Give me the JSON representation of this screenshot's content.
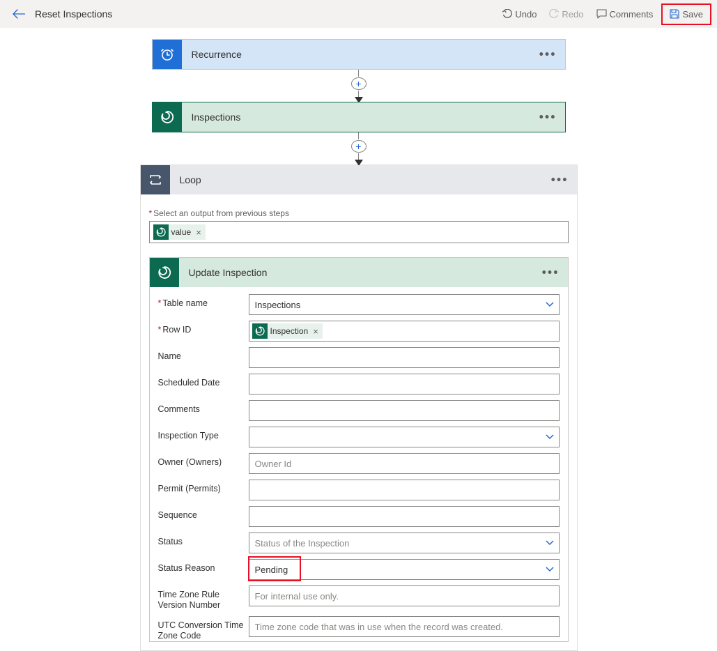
{
  "header": {
    "title": "Reset Inspections",
    "undo": "Undo",
    "redo": "Redo",
    "comments": "Comments",
    "save": "Save"
  },
  "steps": {
    "recurrence": {
      "title": "Recurrence"
    },
    "inspections": {
      "title": "Inspections"
    },
    "loop": {
      "title": "Loop",
      "selectLabel": "Select an output from previous steps",
      "valueToken": "value"
    },
    "update": {
      "title": "Update Inspection",
      "fields": {
        "tableName": {
          "label": "Table name",
          "value": "Inspections",
          "required": true
        },
        "rowId": {
          "label": "Row ID",
          "token": "Inspection",
          "required": true
        },
        "name": {
          "label": "Name"
        },
        "scheduledDate": {
          "label": "Scheduled Date"
        },
        "commentsF": {
          "label": "Comments"
        },
        "inspectionType": {
          "label": "Inspection Type"
        },
        "owner": {
          "label": "Owner (Owners)",
          "placeholder": "Owner Id"
        },
        "permit": {
          "label": "Permit (Permits)"
        },
        "sequence": {
          "label": "Sequence"
        },
        "status": {
          "label": "Status",
          "placeholder": "Status of the Inspection"
        },
        "statusReason": {
          "label": "Status Reason",
          "value": "Pending"
        },
        "tzRule": {
          "label": "Time Zone Rule Version Number",
          "placeholder": "For internal use only."
        },
        "utcOffset": {
          "label": "UTC Conversion Time Zone Code",
          "placeholder": "Time zone code that was in use when the record was created."
        }
      }
    }
  }
}
